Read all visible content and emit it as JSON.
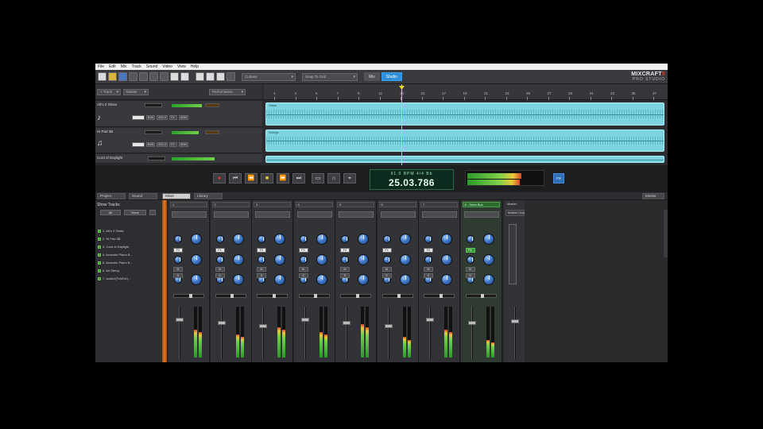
{
  "menu": [
    "File",
    "Edit",
    "Mix",
    "Track",
    "Sound",
    "Video",
    "View",
    "Help"
  ],
  "toolbar": {
    "dropdown1": "Cubase",
    "dropdown2": "Snap To Grid",
    "switch_off": "Mix",
    "switch_on": "Studio"
  },
  "logo": {
    "line1": "MIXCRAFT",
    "line2": "PRO STUDIO",
    "badge": "8"
  },
  "track_header": {
    "btn1": "+ Track",
    "btn2": "Master",
    "btn3": "Performance"
  },
  "ruler": {
    "marks": [
      "1",
      "3",
      "5",
      "7",
      "9",
      "11",
      "13",
      "15",
      "17",
      "19",
      "21",
      "23",
      "25",
      "27",
      "29",
      "31",
      "33",
      "35",
      "37",
      "39"
    ]
  },
  "tracks": [
    {
      "name": "Alt'o 2 Glass",
      "clip": "Glass"
    },
    {
      "name": "Hi Pad 3B",
      "clip": "Strings"
    },
    {
      "name": "Cord of Daylight",
      "clip": ""
    }
  ],
  "track_buttons": [
    "BAN",
    "SOLO",
    "FX",
    "ARM"
  ],
  "transport": {
    "tempo_line": "91.0 BPM  4/4  Bb",
    "time": "25.03.786",
    "fx_label": "FX"
  },
  "tabs": {
    "a": "Project",
    "b": "Sound",
    "c": "Mixer",
    "d": "Library",
    "e": "Master"
  },
  "left_pane": {
    "title": "Show Tracks",
    "btn_all": "All",
    "btn_none": "None",
    "items": [
      "1. Alt'o 2 Glass",
      "2. Hi Pad 3B",
      "3. Cord of Daylight",
      "4. Acoustic Piano B...",
      "5. Acoustic Piano B...",
      "6. Air String",
      "7. audio2(TrA/KA)..."
    ]
  },
  "strips": [
    {
      "label": "1"
    },
    {
      "label": "2"
    },
    {
      "label": "3"
    },
    {
      "label": "4"
    },
    {
      "label": "5"
    },
    {
      "label": "6"
    },
    {
      "label": "7"
    },
    {
      "label": "8 - Send Bus"
    }
  ],
  "master_strip": {
    "label": "Master",
    "hdr": "Master Output"
  },
  "strip_buttons": {
    "fx": "FX",
    "mute": "M",
    "solo": "S"
  },
  "colors": {
    "accent": "#2f8fd8",
    "clip": "#7dd4e0",
    "knob": "#3f78c8",
    "meter_green": "#2aa12a",
    "playhead": "#e6d23a"
  }
}
